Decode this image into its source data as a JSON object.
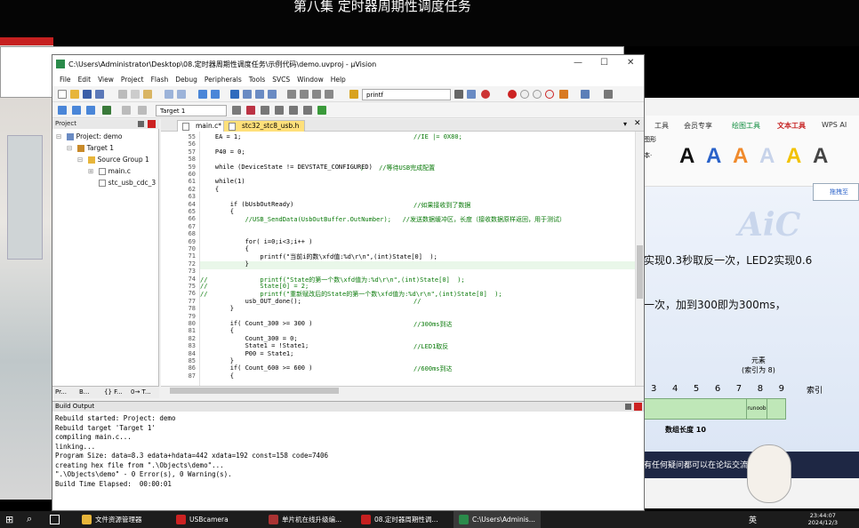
{
  "video_title": "第八集 定时器周期性调度任务",
  "window": {
    "title": "C:\\Users\\Administrator\\Desktop\\08.定时器周期性调度任务\\示例代码\\demo.uvproj - µVision"
  },
  "menu": [
    "File",
    "Edit",
    "View",
    "Project",
    "Flash",
    "Debug",
    "Peripherals",
    "Tools",
    "SVCS",
    "Window",
    "Help"
  ],
  "toolbar": {
    "find_value": "printf",
    "target_value": "Target 1"
  },
  "project": {
    "header": "Project",
    "root": "Project: demo",
    "target": "Target 1",
    "group": "Source Group 1",
    "files": [
      "main.c",
      "stc_usb_cdc_3"
    ],
    "tabs": [
      "Pr...",
      "B...",
      "{} F...",
      "0→ T..."
    ]
  },
  "editor": {
    "tabs": [
      "main.c*",
      "stc32_stc8_usb.h"
    ],
    "lines": [
      {
        "n": "55",
        "code": "    EA = 1;",
        "comment": "//IE |= 0X80;"
      },
      {
        "n": "56",
        "code": "",
        "comment": ""
      },
      {
        "n": "57",
        "code": "    P40 = 0;",
        "comment": ""
      },
      {
        "n": "58",
        "code": "",
        "comment": ""
      },
      {
        "n": "59",
        "code": "    while (DeviceState != DEVSTATE_CONFIGURED)",
        "comment": ";    //等待USB完成配置"
      },
      {
        "n": "60",
        "code": "",
        "comment": ""
      },
      {
        "n": "61",
        "code": "    while(1)",
        "comment": ""
      },
      {
        "n": "62",
        "code": "    {",
        "comment": ""
      },
      {
        "n": "63",
        "code": "",
        "comment": ""
      },
      {
        "n": "64",
        "code": "        if (bUsbOutReady)",
        "comment": "//如果接收到了数据"
      },
      {
        "n": "65",
        "code": "        {",
        "comment": ""
      },
      {
        "n": "66",
        "code": "            //USB_SendData(UsbOutBuffer.OutNumber);   //发送数据缓冲区，长度（接收数据原样返回，用于测试）",
        "comment": ""
      },
      {
        "n": "67",
        "code": "",
        "comment": ""
      },
      {
        "n": "68",
        "code": "",
        "comment": ""
      },
      {
        "n": "69",
        "code": "            for( i=0;i<3;i++ )",
        "comment": ""
      },
      {
        "n": "70",
        "code": "            {",
        "comment": ""
      },
      {
        "n": "71",
        "code": "                printf(\"当前i的数\\xfd值:%d\\r\\n\",(int)State[0]  );",
        "comment": ""
      },
      {
        "n": "72",
        "code": "            }",
        "comment": ""
      },
      {
        "n": "73",
        "code": "",
        "comment": ""
      },
      {
        "n": "74",
        "code": "//              printf(\"State的第一个数\\xfd值为:%d\\r\\n\",(int)State[0]  );",
        "comment": ""
      },
      {
        "n": "75",
        "code": "//              State[0] = 2;",
        "comment": ""
      },
      {
        "n": "76",
        "code": "//              printf(\"重新赋改后的State的第一个数\\xfd值为:%d\\r\\n\",(int)State[0]  );",
        "comment": ""
      },
      {
        "n": "77",
        "code": "            usb_OUT_done();",
        "comment": "//"
      },
      {
        "n": "78",
        "code": "        }",
        "comment": ""
      },
      {
        "n": "79",
        "code": "",
        "comment": ""
      },
      {
        "n": "80",
        "code": "        if( Count_300 >= 300 )",
        "comment": "//300ms到达"
      },
      {
        "n": "81",
        "code": "        {",
        "comment": ""
      },
      {
        "n": "82",
        "code": "            Count_300 = 0;",
        "comment": ""
      },
      {
        "n": "83",
        "code": "            State1 = !State1;",
        "comment": "//LED1取反"
      },
      {
        "n": "84",
        "code": "            P00 = State1;",
        "comment": ""
      },
      {
        "n": "85",
        "code": "        }",
        "comment": ""
      },
      {
        "n": "86",
        "code": "        if( Count_600 >= 600 )",
        "comment": "//600ms到达"
      },
      {
        "n": "87",
        "code": "        {",
        "comment": ""
      }
    ]
  },
  "build": {
    "header": "Build Output",
    "lines": [
      "Rebuild started: Project: demo",
      "Rebuild target 'Target 1'",
      "compiling main.c...",
      "linking...",
      "Program Size: data=8.3 edata+hdata=442 xdata=192 const=158 code=7406",
      "creating hex file from \".\\Objects\\demo\"...",
      "\".\\Objects\\demo\" - 0 Error(s), 0 Warning(s).",
      "Build Time Elapsed:  00:00:01"
    ]
  },
  "wps": {
    "tabs": [
      "工具",
      "会员专享",
      "绘图工具",
      "文本工具",
      "WPS AI"
    ],
    "side_btn": "拖拽至",
    "small1": "图形",
    "small2": "本·"
  },
  "slide": {
    "line1": "实现0.3秒取反一次，LED2实现0.6",
    "line2": "一次，加到300即为300ms，",
    "element": "元素",
    "index_note": "(索引为 8)",
    "indices": [
      "3",
      "4",
      "5",
      "6",
      "7",
      "8",
      "9"
    ],
    "index_label": "索引",
    "cell": "runoob",
    "length": "数组长度 10",
    "caption": "有任何疑问都可以在论坛交流",
    "aic": "AiC"
  },
  "taskbar": {
    "items": [
      "文件资源管理器",
      "USBcamera",
      "单片机在线升级编...",
      "08.定时器周期性调...",
      "C:\\Users\\Adminis..."
    ],
    "time": "23:44:07",
    "date": "2024/12/3",
    "ime": "英"
  },
  "colors": {
    "accent": "#2a62c9",
    "red": "#c62020"
  }
}
